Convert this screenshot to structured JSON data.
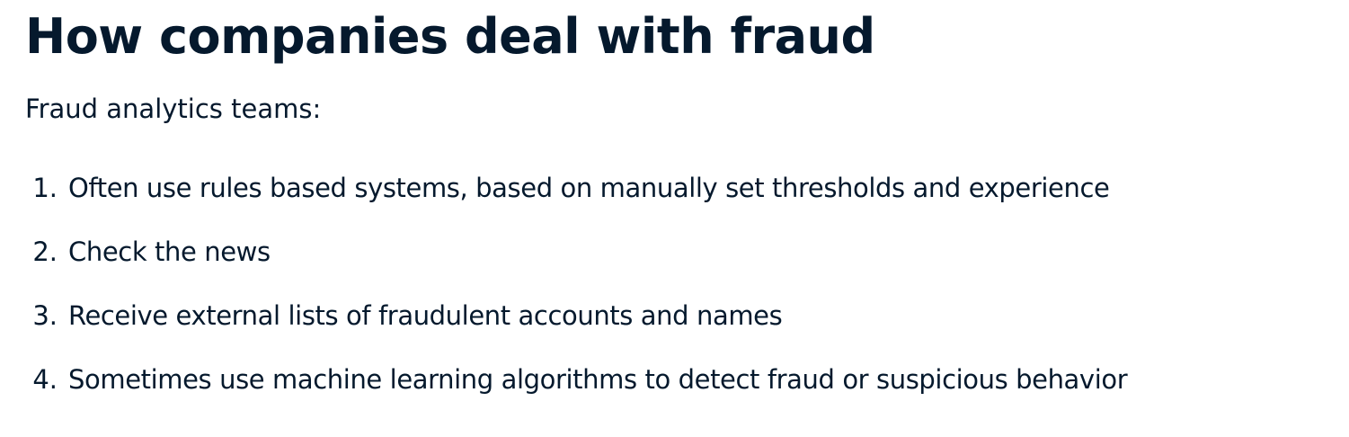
{
  "title": "How companies deal with fraud",
  "subtitle": "Fraud analytics teams:",
  "steps": [
    {
      "number": "1.",
      "text": "Often use rules based systems, based on manually set thresholds and experience"
    },
    {
      "number": "2.",
      "text": "Check the news"
    },
    {
      "number": "3.",
      "text": "Receive external lists of fraudulent accounts and names"
    },
    {
      "number": "4.",
      "text": "Sometimes use machine learning algorithms to detect fraud or suspicious behavior"
    }
  ]
}
